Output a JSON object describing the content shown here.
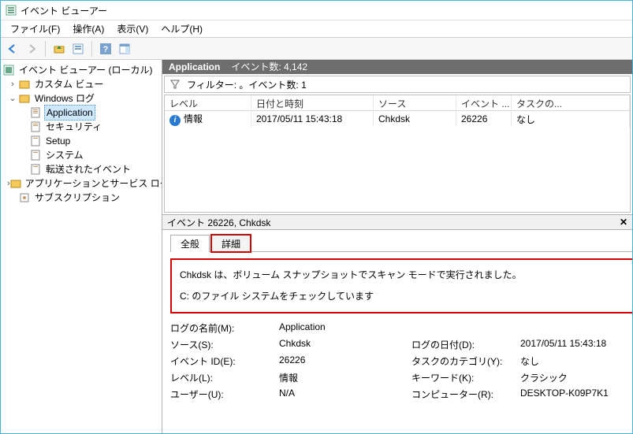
{
  "window": {
    "title": "イベント ビューアー"
  },
  "menu": {
    "file": "ファイル(F)",
    "action": "操作(A)",
    "view": "表示(V)",
    "help": "ヘルプ(H)"
  },
  "tree": {
    "root": "イベント ビューアー (ローカル)",
    "custom_view": "カスタム ビュー",
    "windows_logs": "Windows ログ",
    "app": "Application",
    "security": "セキュリティ",
    "setup": "Setup",
    "system": "システム",
    "forwarded": "転送されたイベント",
    "apps_svc": "アプリケーションとサービス ログ",
    "subscription": "サブスクリプション"
  },
  "section": {
    "name": "Application",
    "count_label": "イベント数: 4,142"
  },
  "filter": {
    "label": "フィルター: 。イベント数: 1"
  },
  "columns": {
    "level": "レベル",
    "datetime": "日付と時刻",
    "source": "ソース",
    "eventid": "イベント ...",
    "task": "タスクの..."
  },
  "row": {
    "level": "情報",
    "datetime": "2017/05/11 15:43:18",
    "source": "Chkdsk",
    "eventid": "26226",
    "task": "なし"
  },
  "detail": {
    "title": "イベント 26226, Chkdsk",
    "tab_general": "全般",
    "tab_detail": "詳細",
    "msg_line1": "Chkdsk は、ボリューム スナップショットでスキャン モードで実行されました。",
    "msg_line2": "C: のファイル システムをチェックしています"
  },
  "kv": {
    "log_name_k": "ログの名前(M):",
    "log_name_v": "Application",
    "source_k": "ソース(S):",
    "source_v": "Chkdsk",
    "log_date_k": "ログの日付(D):",
    "log_date_v": "2017/05/11 15:43:18",
    "event_id_k": "イベント ID(E):",
    "event_id_v": "26226",
    "task_cat_k": "タスクのカテゴリ(Y):",
    "task_cat_v": "なし",
    "level_k": "レベル(L):",
    "level_v": "情報",
    "keywords_k": "キーワード(K):",
    "keywords_v": "クラシック",
    "user_k": "ユーザー(U):",
    "user_v": "N/A",
    "computer_k": "コンピューター(R):",
    "computer_v": "DESKTOP-K09P7K1"
  }
}
